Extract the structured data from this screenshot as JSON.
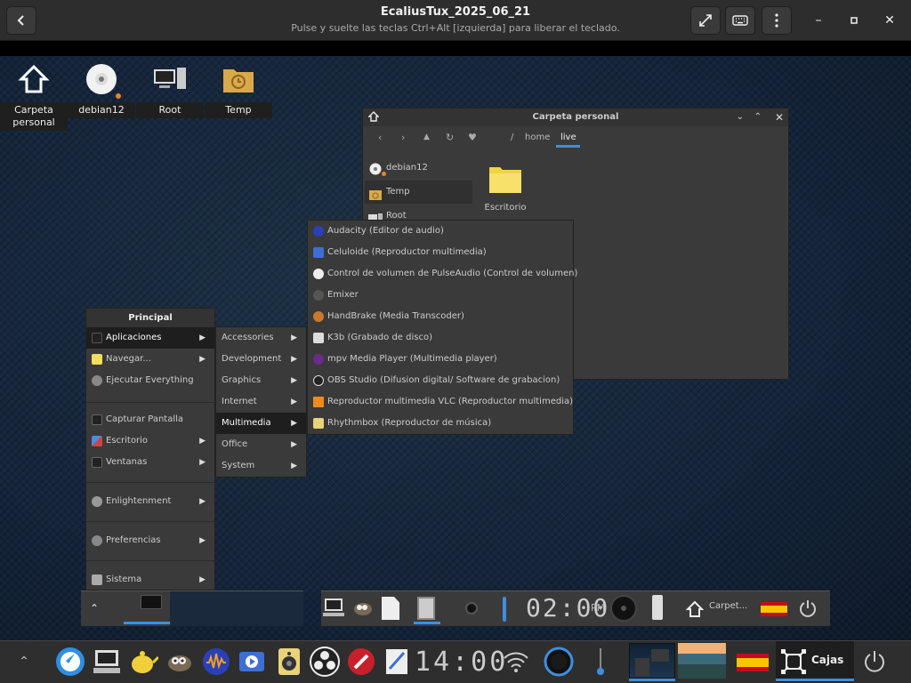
{
  "header": {
    "title": "EcaliusTux_2025_06_21",
    "subtitle": "Pulse y suelte las teclas Ctrl+Alt [izquierda] para liberar el teclado.",
    "back_icon": "chevron-left-icon",
    "fullscreen_icon": "expand-icon",
    "keyboard_icon": "keyboard-icon",
    "menu_icon": "kebab-menu-icon",
    "minimize": "–",
    "maximize": "▫",
    "close": "✕"
  },
  "desktop_icons": [
    {
      "label": "Carpeta personal"
    },
    {
      "label": "debian12"
    },
    {
      "label": "Root"
    },
    {
      "label": "Temp"
    }
  ],
  "file_manager": {
    "title": "Carpeta personal",
    "breadcrumb": [
      "/",
      "home",
      "live"
    ],
    "sidebar": [
      "debian12",
      "Temp",
      "Root"
    ],
    "items": [
      "Escritorio"
    ]
  },
  "main_menu": {
    "title": "Principal",
    "items": [
      {
        "label": "Aplicaciones",
        "submenu": true
      },
      {
        "label": "Navegar...",
        "submenu": true
      },
      {
        "label": "Ejecutar Everything",
        "submenu": false
      },
      {
        "label": "Capturar Pantalla",
        "submenu": false
      },
      {
        "label": "Escritorio",
        "submenu": true
      },
      {
        "label": "Ventanas",
        "submenu": true
      },
      {
        "label": "Enlightenment",
        "submenu": true
      },
      {
        "label": "Preferencias",
        "submenu": true
      },
      {
        "label": "Sistema",
        "submenu": true
      }
    ]
  },
  "apps_menu": {
    "items": [
      "Accessories",
      "Development",
      "Graphics",
      "Internet",
      "Multimedia",
      "Office",
      "System"
    ]
  },
  "multimedia_menu": {
    "items": [
      "Audacity (Editor de audio)",
      "Celuloide (Reproductor multimedia)",
      "Control de volumen de PulseAudio (Control de volumen)",
      "Emixer",
      "HandBrake (Media Transcoder)",
      "K3b (Grabado de disco)",
      "mpv Media Player (Multimedia player)",
      "OBS Studio (Difusion digital/ Software de grabacion)",
      "Reproductor multimedia VLC (Reproductor multimedia)",
      "Rhythmbox (Reproductor de música)"
    ]
  },
  "vm_shelf": {
    "clock_time": "02:00",
    "clock_ampm": "PM",
    "task_label": "Carpet..."
  },
  "dock": {
    "clock": "14:00",
    "cajas_label": "Cajas"
  },
  "colors": {
    "accent": "#3d8fe0",
    "menu_bg": "#3a3a3a",
    "selected_bg": "#1e1e1e"
  }
}
